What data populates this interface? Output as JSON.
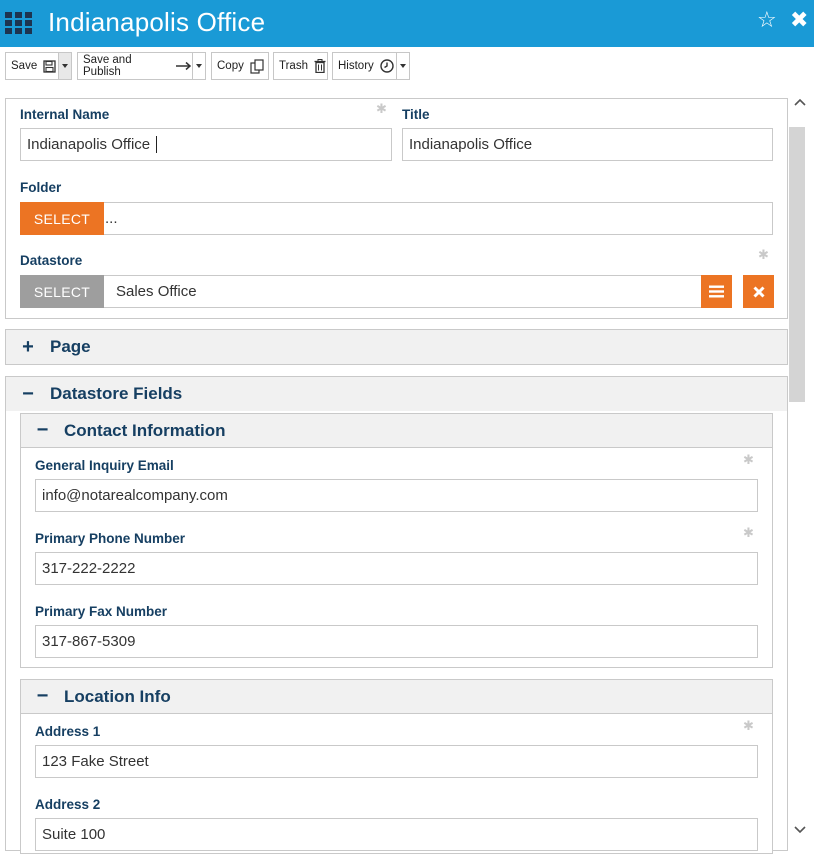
{
  "window": {
    "title": "Indianapolis Office",
    "icons": {
      "apps": "app-grid-icon",
      "favorite": "star-icon",
      "close": "close-icon"
    }
  },
  "toolbar": {
    "save_label": "Save",
    "save_publish_label": "Save and Publish",
    "copy_label": "Copy",
    "trash_label": "Trash",
    "history_label": "History"
  },
  "form": {
    "internal_name": {
      "label": "Internal Name",
      "value": "Indianapolis Office"
    },
    "title": {
      "label": "Title",
      "value": "Indianapolis Office"
    },
    "folder": {
      "label": "Folder",
      "select_label": "SELECT",
      "value": "..."
    },
    "datastore": {
      "label": "Datastore",
      "select_label": "SELECT",
      "value": "Sales Office"
    }
  },
  "sections": {
    "page": {
      "symbol": "+",
      "label": "Page"
    },
    "datastore_fields": {
      "symbol": "−",
      "label": "Datastore Fields"
    }
  },
  "contact_info": {
    "symbol": "−",
    "label": "Contact Information",
    "email": {
      "label": "General Inquiry Email",
      "value": "info@notarealcompany.com"
    },
    "phone": {
      "label": "Primary Phone Number",
      "value": "317-222-2222"
    },
    "fax": {
      "label": "Primary Fax Number",
      "value": "317-867-5309"
    }
  },
  "location_info": {
    "symbol": "−",
    "label": "Location Info",
    "address1": {
      "label": "Address 1",
      "value": "123 Fake Street"
    },
    "address2": {
      "label": "Address 2",
      "value": "Suite 100"
    }
  },
  "colors": {
    "header": "#1a9ad6",
    "accent_orange": "#ec7423",
    "label_navy": "#163f62",
    "select_grey": "#9e9e9e"
  }
}
